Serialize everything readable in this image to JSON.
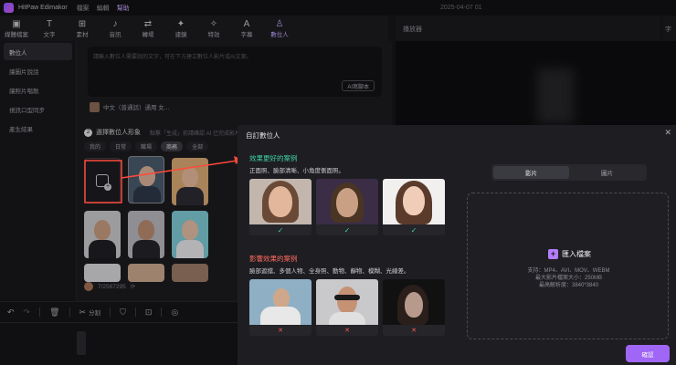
{
  "titlebar": {
    "app_name": "HitPaw Edimakor",
    "menu": [
      "檔案",
      "編輯",
      "幫助"
    ],
    "date": "2025-04-07 01"
  },
  "toolbar": {
    "tools": [
      {
        "icon": "media-icon",
        "glyph": "▣",
        "label": "媒體檔案"
      },
      {
        "icon": "text-icon",
        "glyph": "T",
        "label": "文字"
      },
      {
        "icon": "elements-icon",
        "glyph": "⊞",
        "label": "素材"
      },
      {
        "icon": "audio-icon",
        "glyph": "♪",
        "label": "音訊"
      },
      {
        "icon": "transition-icon",
        "glyph": "⇄",
        "label": "轉場"
      },
      {
        "icon": "filter-icon",
        "glyph": "✦",
        "label": "濾鏡"
      },
      {
        "icon": "effects-icon",
        "glyph": "✧",
        "label": "特效"
      },
      {
        "icon": "subtitle-icon",
        "glyph": "A",
        "label": "字幕"
      },
      {
        "icon": "digital-human-icon",
        "glyph": "♙",
        "label": "數位人"
      }
    ],
    "active_index": 8
  },
  "preview_title": "播放器",
  "preview_title2": "字",
  "sidebar": {
    "items": [
      "數位人",
      "讓圖片說話",
      "讓照片唱歌",
      "視訊口型同步",
      "產生結果"
    ],
    "active_index": 0
  },
  "main": {
    "prompt_placeholder": "請輸入數位人需要說的文字，可在下方建立數位人影片或AI文案。",
    "ai_button": "AI寫腳本",
    "voice_label": "中文（普通話）通用 女...",
    "section_number": "2",
    "section_title": "選擇數位人形象",
    "section_hint": "點擊「生成」前請確認 AI 已完成影片處理",
    "filters": [
      "我的",
      "日常",
      "職場",
      "商務",
      "全部"
    ],
    "active_filter": 3,
    "counter": "7/2587295"
  },
  "timeline": {
    "split_label": "分割"
  },
  "modal": {
    "title": "自訂數位人",
    "good_title": "效果更好的案例",
    "good_desc": "正面照、臉部清晰、小角度側面照。",
    "bad_title": "影響效果的案例",
    "bad_desc": "臉部遮擋、多個人物、全身照、動物、靜物、模糊、光線差。",
    "tabs": [
      "影片",
      "圖片"
    ],
    "active_tab": 0,
    "import_label": "匯入檔案",
    "support_line": "支持：MP4、AVI、MOV、WEBM",
    "size_line": "最大影片檔案大小：250MB",
    "resolution_line": "最高解析度：3840*3840",
    "confirm_label": "確認",
    "colors": {
      "good": "#3fd1a3",
      "bad": "#ff6b5f",
      "accent": "#a066f5"
    }
  }
}
